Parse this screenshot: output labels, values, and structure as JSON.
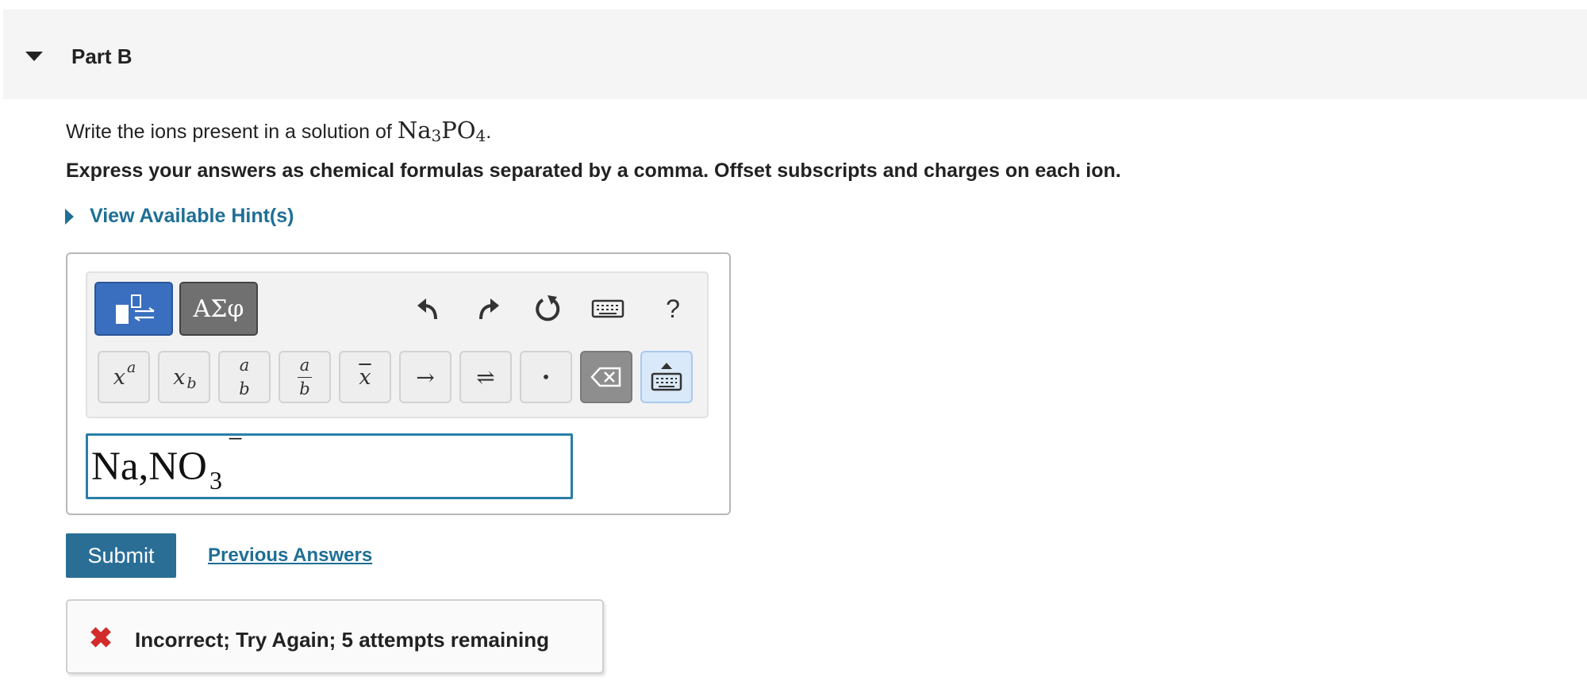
{
  "part": {
    "title": "Part B"
  },
  "question": {
    "prefix": "Write the ions present in a solution of ",
    "formula_na": "Na",
    "formula_na_sub": "3",
    "formula_po": "PO",
    "formula_po_sub": "4",
    "suffix": "."
  },
  "instructions": "Express your answers as chemical formulas separated by a comma. Offset subscripts and charges on each ion.",
  "hints": {
    "label": "View Available Hint(s)"
  },
  "toolbar": {
    "greek_label": "ΑΣφ",
    "help_label": "?",
    "keys": {
      "superscript": {
        "base": "x",
        "exp": "a"
      },
      "subscript": {
        "base": "x",
        "sub": "b"
      },
      "fraction": {
        "num": "a",
        "den": "b"
      },
      "inline_fraction": {
        "num": "a",
        "den": "b"
      },
      "overline": "x",
      "arrow": "→",
      "equilibrium": "⇌",
      "dot": "•"
    }
  },
  "answer_input": {
    "text": "Na,NO",
    "subscript": "3",
    "superscript": "−"
  },
  "submit_label": "Submit",
  "previous_answers_label": "Previous Answers",
  "feedback": {
    "icon": "✖",
    "message": "Incorrect; Try Again; 5 attempts remaining"
  },
  "colors": {
    "accent": "#2a6e96",
    "link": "#1f6f95",
    "error": "#d12b2b",
    "template_button": "#3a6fbf",
    "greek_button": "#707070"
  },
  "icons": [
    "collapse-caret-icon",
    "expand-caret-icon",
    "templates-icon",
    "undo-icon",
    "redo-icon",
    "reset-icon",
    "keyboard-icon",
    "backspace-icon",
    "keyboard-toggle-icon",
    "error-x-icon"
  ]
}
